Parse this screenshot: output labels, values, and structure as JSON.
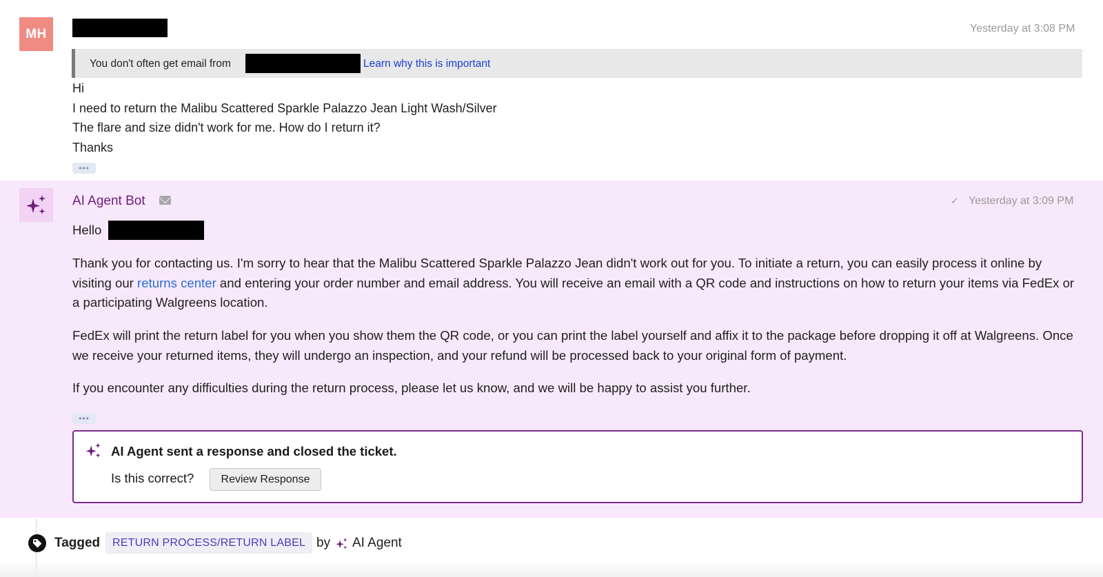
{
  "customer_message": {
    "avatar_initials": "MH",
    "timestamp": "Yesterday at 3:08 PM",
    "notice_text": "You don't often get email from",
    "notice_link": "Learn why this is important",
    "lines": [
      "Hi",
      "I need to return the Malibu Scattered Sparkle Palazzo Jean Light Wash/Silver",
      "The flare and size didn't work for me. How do I return it?",
      "Thanks"
    ],
    "more_label": "•••"
  },
  "ai_message": {
    "sender": "AI Agent Bot",
    "timestamp": "Yesterday at 3:09 PM",
    "greeting": "Hello",
    "para1_before": "Thank you for contacting us. I'm sorry to hear that the Malibu Scattered Sparkle Palazzo Jean didn't work out for you. To initiate a return, you can easily process it online by visiting our ",
    "para1_link": "returns center",
    "para1_after": " and entering your order number and email address. You will receive an email with a QR code and instructions on how to return your items via FedEx or a participating Walgreens location.",
    "para2": "FedEx will print the return label for you when you show them the QR code, or you can print the label yourself and affix it to the package before dropping it off at Walgreens. Once we receive your returned items, they will undergo an inspection, and your refund will be processed back to your original form of payment.",
    "para3": "If you encounter any difficulties during the return process, please let us know, and we will be happy to assist you further.",
    "more_label": "•••",
    "callout_title": "AI Agent sent a response and closed the ticket.",
    "callout_question": "Is this correct?",
    "review_button": "Review Response"
  },
  "tag_event": {
    "label": "Tagged",
    "tag": "RETURN PROCESS/RETURN LABEL",
    "by": "by",
    "actor": "AI Agent"
  },
  "colors": {
    "avatar_bg": "#f08b84",
    "ai_bg": "#f8e8fb",
    "ai_accent": "#6d1d7d",
    "link": "#2a6fd6",
    "tag_text": "#5437b8"
  },
  "icons": {
    "ai_avatar": "sparkle-icon",
    "sender_channel": "mail-icon",
    "delivered": "check-icon",
    "tag": "tag-icon"
  }
}
